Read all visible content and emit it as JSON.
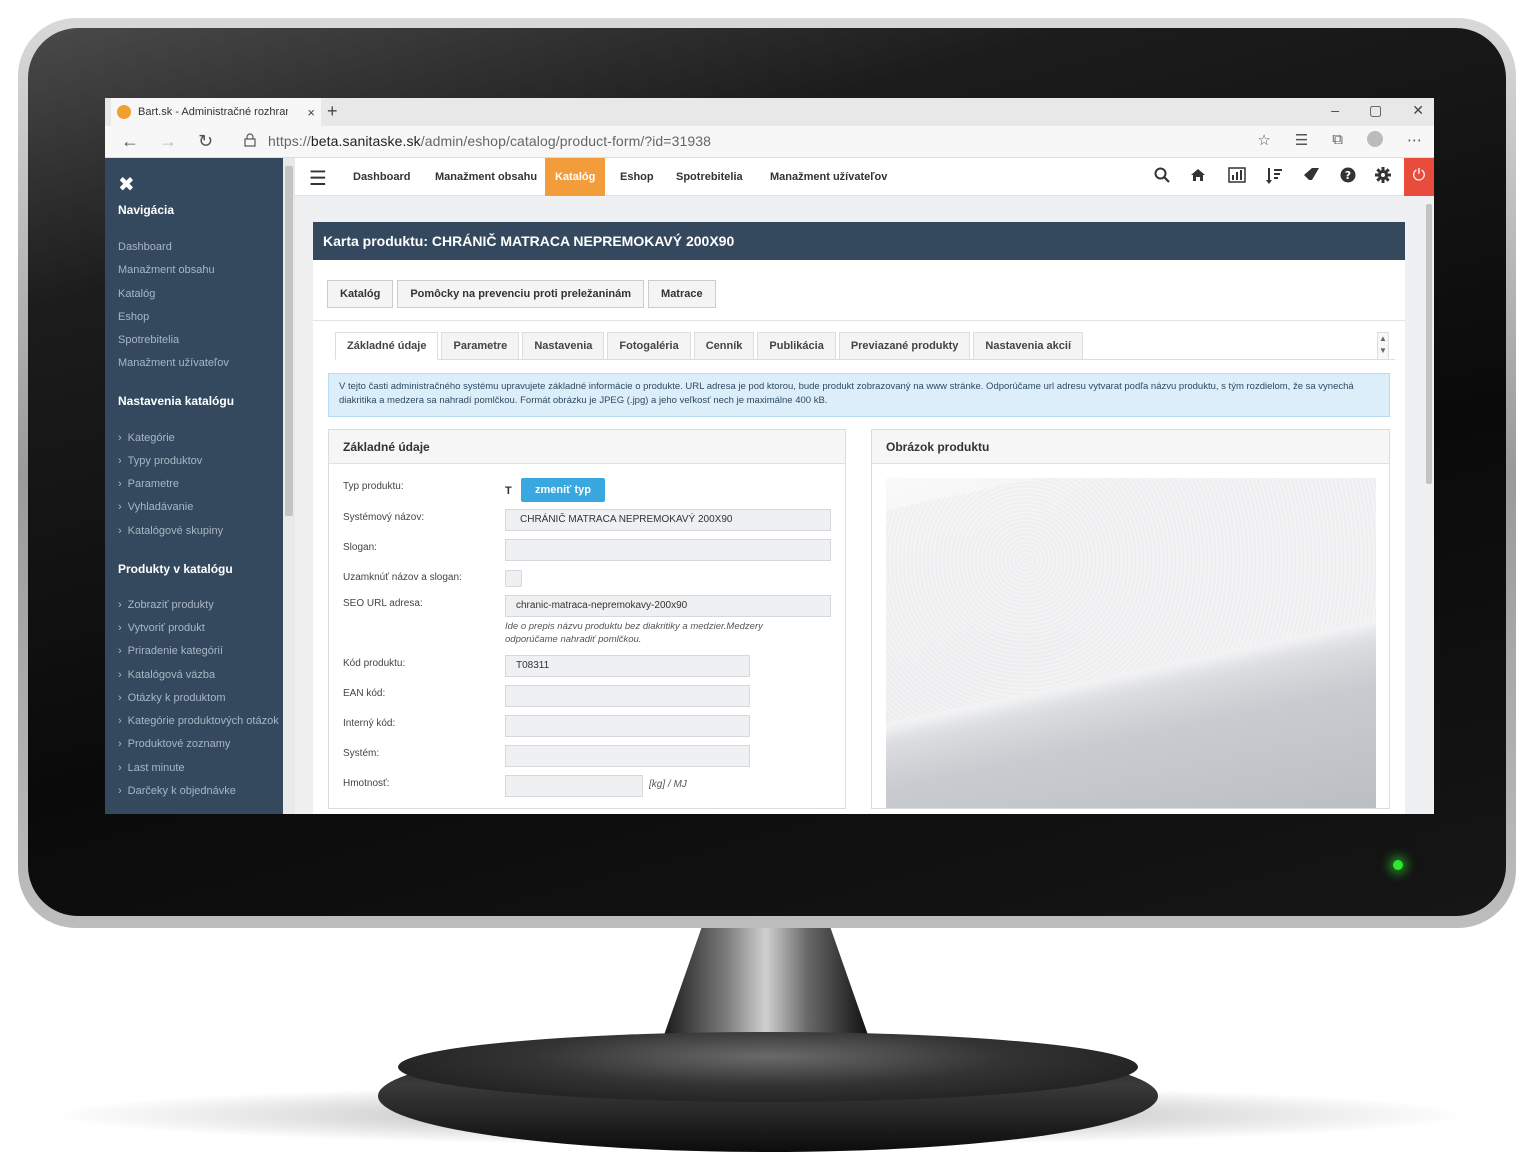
{
  "browser": {
    "tab_title": "Bart.sk - Administračné rozhranie",
    "tab_close": "×",
    "new_tab": "+",
    "url_prefix": "https://",
    "url_host": "beta.sanitaske.sk",
    "url_path": "/admin/eshop/catalog/product-form/?id=31938",
    "window_buttons": [
      "–",
      "▢",
      "✕"
    ],
    "nav_icons": [
      "back-arrow-icon",
      "forward-arrow-icon",
      "refresh-icon",
      "lock-icon"
    ],
    "toolbar_icons": [
      "star-icon",
      "favorites-icon",
      "collections-icon",
      "profile-icon",
      "more-icon"
    ]
  },
  "sidebar": {
    "close_glyph": "✖",
    "nav_heading": "Navigácia",
    "nav_items": [
      "Dashboard",
      "Manažment obsahu",
      "Katalóg",
      "Eshop",
      "Spotrebitelia",
      "Manažment užívateľov"
    ],
    "catalog_settings_heading": "Nastavenia katalógu",
    "catalog_settings_items": [
      "Kategórie",
      "Typy produktov",
      "Parametre",
      "Vyhladávanie",
      "Katalógové skupiny"
    ],
    "products_heading": "Produkty v katalógu",
    "products_items": [
      "Zobraziť produkty",
      "Vytvoriť produkt",
      "Priradenie kategórií",
      "Katalógová väzba",
      "Otázky k produktom",
      "Kategórie produktových otázok",
      "Produktové zoznamy",
      "Last minute",
      "Darčeky k objednávke"
    ]
  },
  "topnav": {
    "links": [
      "Dashboard",
      "Manažment obsahu",
      "Katalóg",
      "Eshop",
      "Spotrebitelia",
      "Manažment užívateľov"
    ],
    "active": "Katalóg",
    "icons": [
      "search-icon",
      "home-icon",
      "chart-icon",
      "sort-icon",
      "eraser-icon",
      "help-icon",
      "gear-icon",
      "power-icon"
    ],
    "accent_color": "#f39c3c",
    "power_color": "#e74c3c"
  },
  "card": {
    "title": "Karta produktu: CHRÁNIČ MATRACA NEPREMOKAVÝ 200X90",
    "breadcrumbs": [
      "Katalóg",
      "Pomôcky na prevenciu proti preležaninám",
      "Matrace"
    ],
    "tabs": [
      "Základné údaje",
      "Parametre",
      "Nastavenia",
      "Fotogaléria",
      "Cenník",
      "Publikácia",
      "Previazané produkty",
      "Nastavenia akcií"
    ],
    "active_tab": "Základné údaje",
    "info_text": "V tejto časti administračného systému upravujete základné informácie o produkte. URL adresa je pod ktorou, bude produkt zobrazovaný na www stránke. Odporúčame url adresu vytvarat podľa názvu produktu, s tým rozdielom, že sa vynechá diakritika a medzera sa nahradí pomlčkou. Formát obrázku je JPEG (.jpg) a jeho veľkosť nech je maximálne 400 kB."
  },
  "basic_panel": {
    "heading": "Základné údaje",
    "type_label": "Typ produktu:",
    "type_value": "T",
    "change_type_button": "zmeniť typ",
    "system_name_label": "Systémový názov:",
    "system_name_value": "CHRÁNIČ MATRACA NEPREMOKAVÝ 200X90",
    "slogan_label": "Slogan:",
    "slogan_value": "",
    "lock_label": "Uzamknúť názov a slogan:",
    "seo_label": "SEO URL adresa:",
    "seo_value": "chranic-matraca-nepremokavy-200x90",
    "seo_help": "Ide o prepis názvu produktu bez diakritiky a medzier.Medzery odporúčame nahradiť pomlčkou.",
    "code_label": "Kód produktu:",
    "code_value": "T08311",
    "ean_label": "EAN kód:",
    "ean_value": "",
    "internal_label": "Interný kód:",
    "internal_value": "",
    "system_label": "Systém:",
    "system_value": "",
    "weight_label": "Hmotnosť:",
    "weight_value": "",
    "weight_unit": "[kg] / MJ"
  },
  "image_panel": {
    "heading": "Obrázok produktu"
  }
}
